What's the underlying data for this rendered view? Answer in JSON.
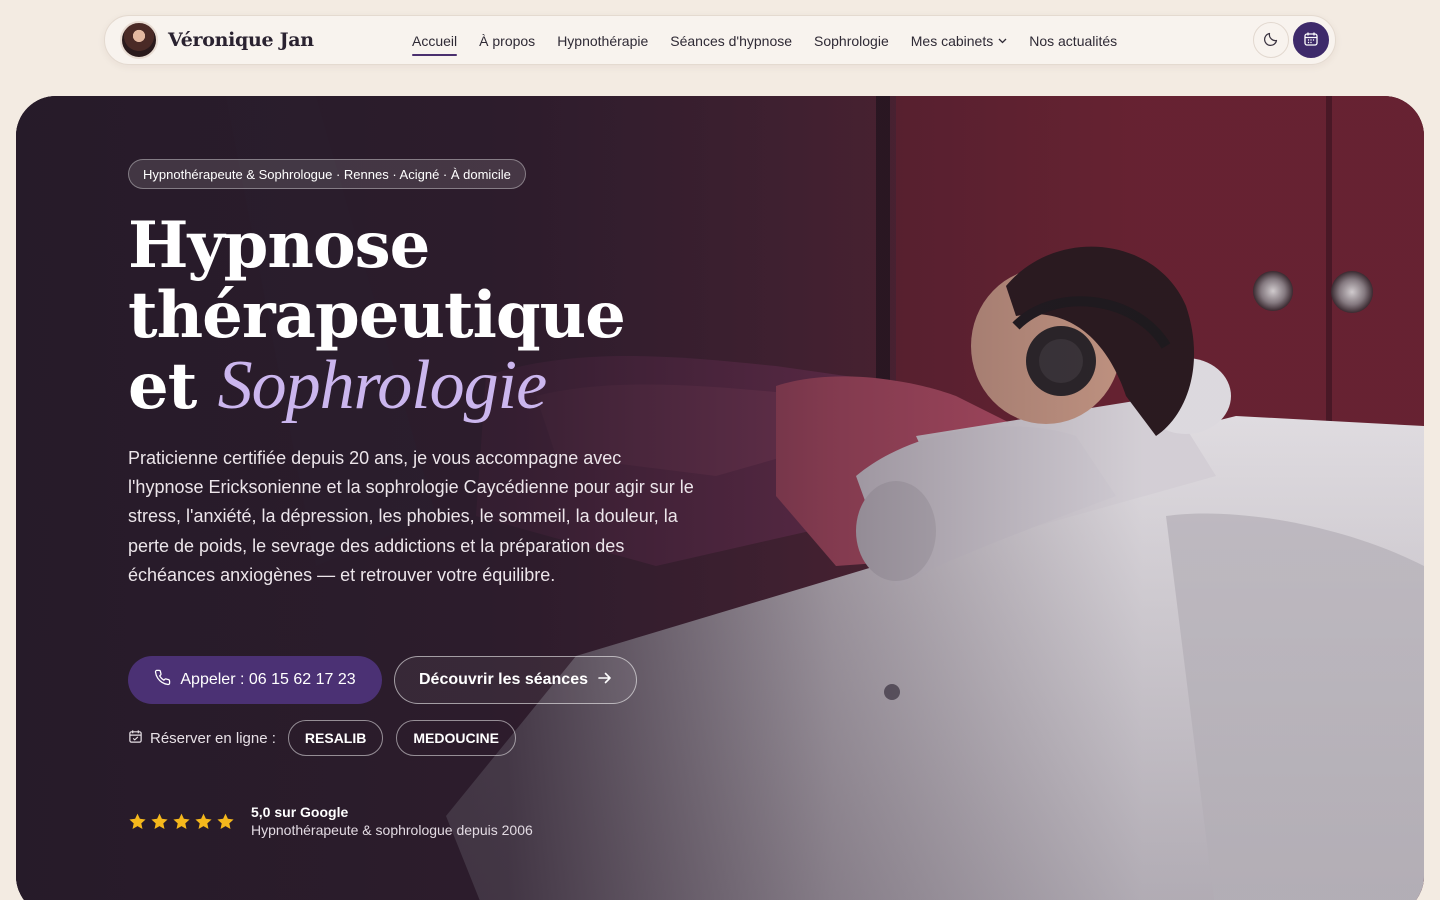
{
  "brand": {
    "name": "Véronique Jan",
    "avatar_icon": "portrait-avatar"
  },
  "nav": {
    "items": [
      {
        "label": "Accueil",
        "active": true
      },
      {
        "label": "À propos"
      },
      {
        "label": "Hypnothérapie"
      },
      {
        "label": "Séances d'hypnose"
      },
      {
        "label": "Sophrologie"
      },
      {
        "label": "Mes cabinets",
        "dropdown": true
      },
      {
        "label": "Nos actualités"
      }
    ],
    "theme_toggle_icon": "moon-icon",
    "booking_icon": "calendar-icon"
  },
  "hero": {
    "eyebrow": "Hypnothérapeute & Sophrologue · Rennes · Acigné · À domicile",
    "title_line1": "Hypnose",
    "title_line2": "thérapeutique",
    "title_line3_prefix": "et",
    "title_line3_accent": "Sophrologie",
    "lead": "Praticienne certifiée depuis 20 ans, je vous accompagne avec l'hypnose Ericksonienne et la sophrologie Caycédienne pour agir sur le stress, l'anxiété, la dépression, les phobies, le sommeil, la douleur, la perte de poids, le sevrage des addictions et la préparation des échéances anxiogènes — et retrouver votre équilibre.",
    "cta_call": "Appeler : 06 15 62 17 23",
    "cta_sessions": "Découvrir les séances",
    "reserve_label": "Réserver en ligne :",
    "reserve_options": [
      "RESALIB",
      "MEDOUCINE"
    ],
    "rating": {
      "stars": 5,
      "title": "5,0 sur Google",
      "subtitle": "Hypnothérapeute & sophrologue depuis 2006"
    }
  },
  "colors": {
    "page_bg": "#f3ebe2",
    "primary": "#4b3174",
    "accent_text": "#cbb6ee",
    "star": "#f5b81c"
  }
}
